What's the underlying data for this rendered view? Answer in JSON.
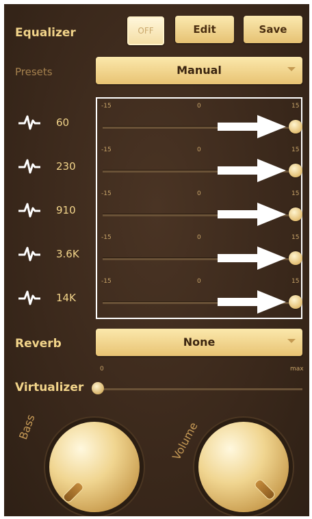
{
  "header": {
    "title": "Equalizer",
    "off_label": "OFF",
    "edit_label": "Edit",
    "save_label": "Save"
  },
  "presets": {
    "label": "Presets",
    "selected": "Manual"
  },
  "bands": [
    {
      "freq": "60",
      "min": "-15",
      "mid": "0",
      "max": "15",
      "value": 15
    },
    {
      "freq": "230",
      "min": "-15",
      "mid": "0",
      "max": "15",
      "value": 15
    },
    {
      "freq": "910",
      "min": "-15",
      "mid": "0",
      "max": "15",
      "value": 15
    },
    {
      "freq": "3.6K",
      "min": "-15",
      "mid": "0",
      "max": "15",
      "value": 15
    },
    {
      "freq": "14K",
      "min": "-15",
      "mid": "0",
      "max": "15",
      "value": 15
    }
  ],
  "reverb": {
    "label": "Reverb",
    "selected": "None"
  },
  "virtualizer": {
    "label": "Virtualizer",
    "min_label": "0",
    "max_label": "max",
    "value": 0
  },
  "knobs": {
    "bass_label": "Bass",
    "volume_label": "Volume"
  },
  "colors": {
    "background": "#3a281b",
    "gold": "#f2d48a",
    "arrow": "#ffffff"
  }
}
